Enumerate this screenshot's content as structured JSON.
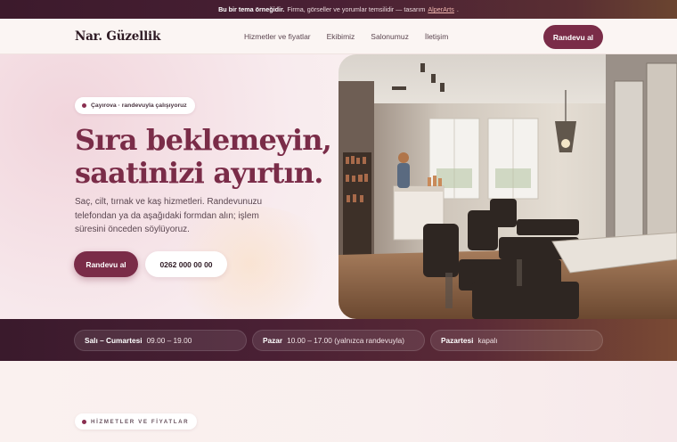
{
  "announcement": {
    "bold": "Bu bir tema örneğidir.",
    "text": "Firma, görseller ve yorumlar temsilidir — tasarım",
    "link": "AlperArts",
    "end": "."
  },
  "header": {
    "brand": "Nar. Güzellik",
    "nav": [
      "Hizmetler ve fiyatlar",
      "Ekibimiz",
      "Salonumuz",
      "İletişim"
    ],
    "cta": "Randevu al"
  },
  "hero": {
    "badge": "Çayırova · randevuyla çalışıyoruz",
    "headline_line1": "Sıra beklemeyin,",
    "headline_line2": "saatinizi ayırtın.",
    "lead": "Saç, cilt, tırnak ve kaş hizmetleri. Randevunuzu telefondan ya da aşağıdaki formdan alın; işlem süresini önceden söylüyoruz.",
    "primary_button": "Randevu al",
    "phone_button": "0262 000 00 00",
    "photo_icon": "salon-interior-photo"
  },
  "hours": [
    {
      "day": "Salı – Cumartesi",
      "time": "09.00 – 19.00"
    },
    {
      "day": "Pazar",
      "time": "10.00 – 17.00 (yalnızca randevuyla)"
    },
    {
      "day": "Pazartesi",
      "time": "kapalı"
    }
  ],
  "services": {
    "section_label": "HİZMETLER VE FİYATLAR"
  },
  "colors": {
    "brand": "#7a2c48",
    "dark": "#3c1a2c",
    "background": "#faf1ee"
  }
}
